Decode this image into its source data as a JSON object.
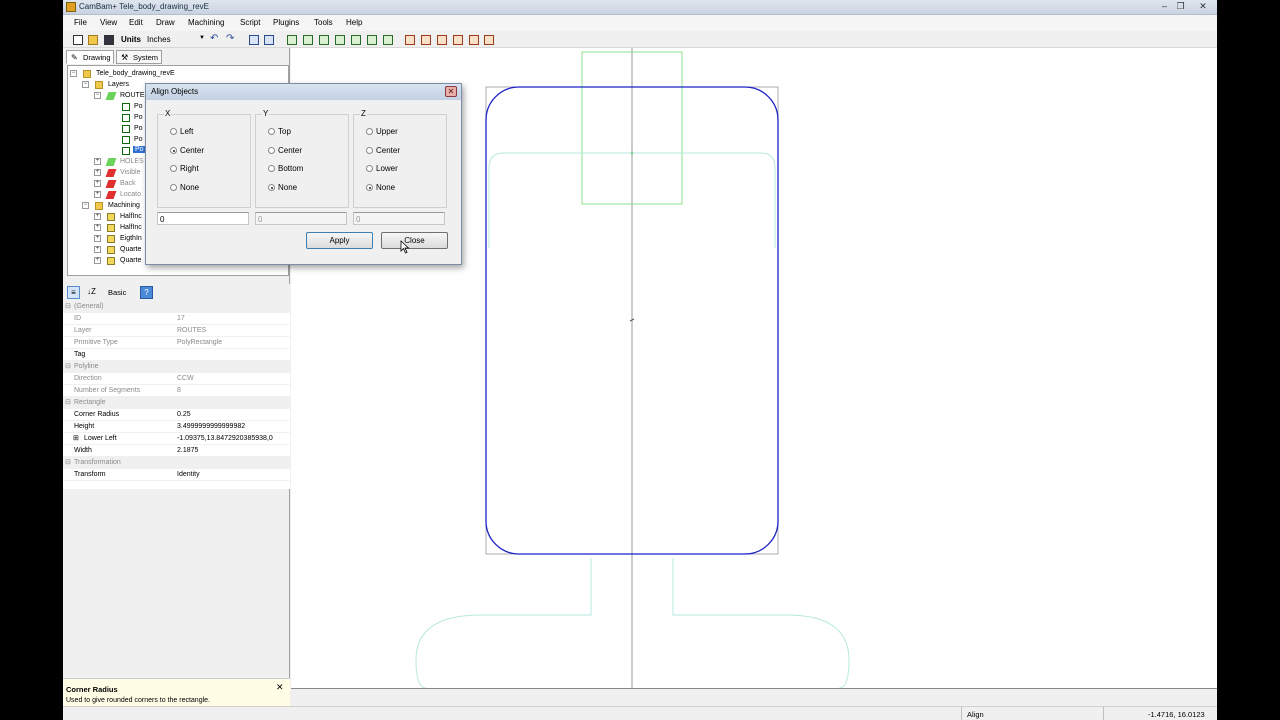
{
  "window": {
    "title": "CamBam+  Tele_body_drawing_revE",
    "app_icon": "cambam-icon",
    "controls": [
      "minimize-icon",
      "maximize-icon",
      "close-icon"
    ]
  },
  "menu": [
    "File",
    "View",
    "Edit",
    "Draw",
    "Machining",
    "Script",
    "Plugins",
    "Tools",
    "Help"
  ],
  "toolbar": {
    "units_label": "Units",
    "units_value": "Inches"
  },
  "left_tabs": [
    "Drawing",
    "System"
  ],
  "tree": {
    "root": "Tele_body_drawing_revE",
    "layers": "Layers",
    "routes": "ROUTES",
    "polys": [
      "Po",
      "Po",
      "Po",
      "Po",
      "Po"
    ],
    "layer_items": [
      "HOLES",
      "Visible",
      "Back",
      "Locato"
    ],
    "machining": "Machining",
    "machining_items": [
      "HalfInc",
      "HalfInc",
      "EigthIn",
      "Quarte",
      "Quarte"
    ]
  },
  "props_toolbar": {
    "mode": "Basic"
  },
  "properties": {
    "general": "(General)",
    "id_key": "ID",
    "id_val": "17",
    "layer_key": "Layer",
    "layer_val": "ROUTES",
    "ptype_key": "Primitive Type",
    "ptype_val": "PolyRectangle",
    "tag_key": "Tag",
    "tag_val": "",
    "polyline": "Polyline",
    "dir_key": "Direction",
    "dir_val": "CCW",
    "nseg_key": "Number of Segments",
    "nseg_val": "8",
    "rectangle": "Rectangle",
    "cr_key": "Corner Radius",
    "cr_val": "0.25",
    "h_key": "Height",
    "h_val": "3.4999999999999982",
    "ll_key": "Lower Left",
    "ll_val": "-1.09375,13.8472920385938,0",
    "w_key": "Width",
    "w_val": "2.1875",
    "transformation": "Transformation",
    "tf_key": "Transform",
    "tf_val": "Identity"
  },
  "help": {
    "title": "Corner Radius",
    "text": "Used to give rounded corners to the rectangle."
  },
  "dialog": {
    "title": "Align Objects",
    "x": {
      "label": "X",
      "options": [
        "Left",
        "Center",
        "Right",
        "None"
      ],
      "selected": "Center",
      "value": "0"
    },
    "y": {
      "label": "Y",
      "options": [
        "Top",
        "Center",
        "Bottom",
        "None"
      ],
      "selected": "None",
      "value": "0"
    },
    "z": {
      "label": "Z",
      "options": [
        "Upper",
        "Center",
        "Lower",
        "None"
      ],
      "selected": "None",
      "value": "0"
    },
    "apply": "Apply",
    "close": "Close"
  },
  "status": {
    "mode": "Align",
    "coords": "-1.4716, 16.0123"
  },
  "colors": {
    "selected_outline": "#1a22c8",
    "layer_cyan": "#b8e8e0",
    "layer_green": "#8ee08e",
    "axis": "#999999"
  }
}
